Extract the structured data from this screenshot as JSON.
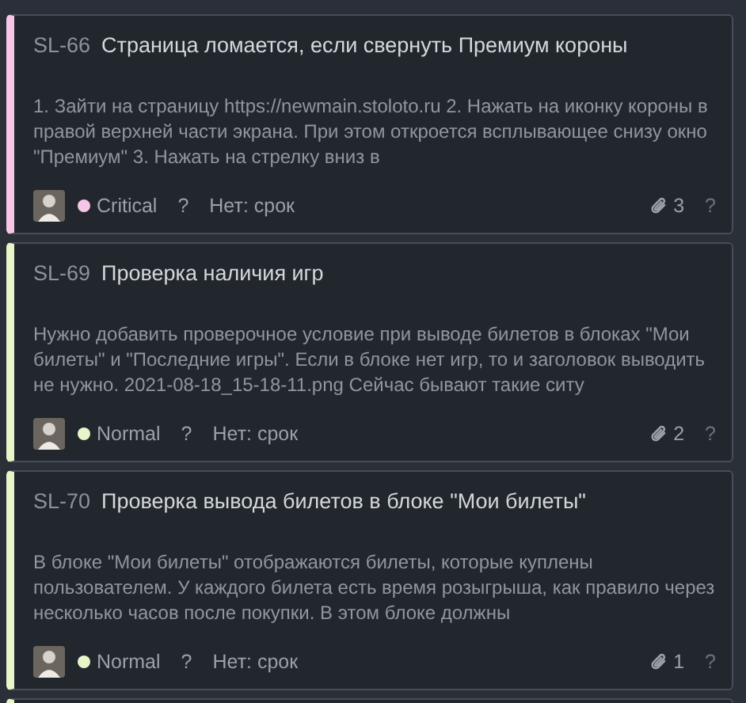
{
  "cards": [
    {
      "key": "SL-66",
      "title": "Страница ломается, если свернуть Премиум короны",
      "description": "1. Зайти на страницу https://newmain.stoloto.ru 2. Нажать на иконку короны в правой верхней части экрана. При этом откроется всплывающее снизу окно \"Премиум\" 3. Нажать на стрелку вниз в",
      "priority": "Critical",
      "color": "#f7c6e6",
      "estimate": "?",
      "due": "Нет: срок",
      "attachments": "3",
      "points": "?"
    },
    {
      "key": "SL-69",
      "title": "Проверка наличия игр",
      "description": "Нужно добавить проверочное условие при выводе билетов в блоках \"Мои билеты\" и \"Последние игры\". Если в блоке нет игр, то и заголовок выводить не нужно. 2021-08-18_15-18-11.png Сейчас бывают такие ситу",
      "priority": "Normal",
      "color": "#e8f5c8",
      "estimate": "?",
      "due": "Нет: срок",
      "attachments": "2",
      "points": "?"
    },
    {
      "key": "SL-70",
      "title": "Проверка вывода билетов в блоке \"Мои билеты\"",
      "description": "В блоке \"Мои билеты\" отображаются билеты, которые куплены пользователем. У каждого билета есть время розыгрыша, как правило через несколько часов после покупки. В этом блоке должны",
      "priority": "Normal",
      "color": "#e8f5c8",
      "estimate": "?",
      "due": "Нет: срок",
      "attachments": "1",
      "points": "?"
    }
  ]
}
